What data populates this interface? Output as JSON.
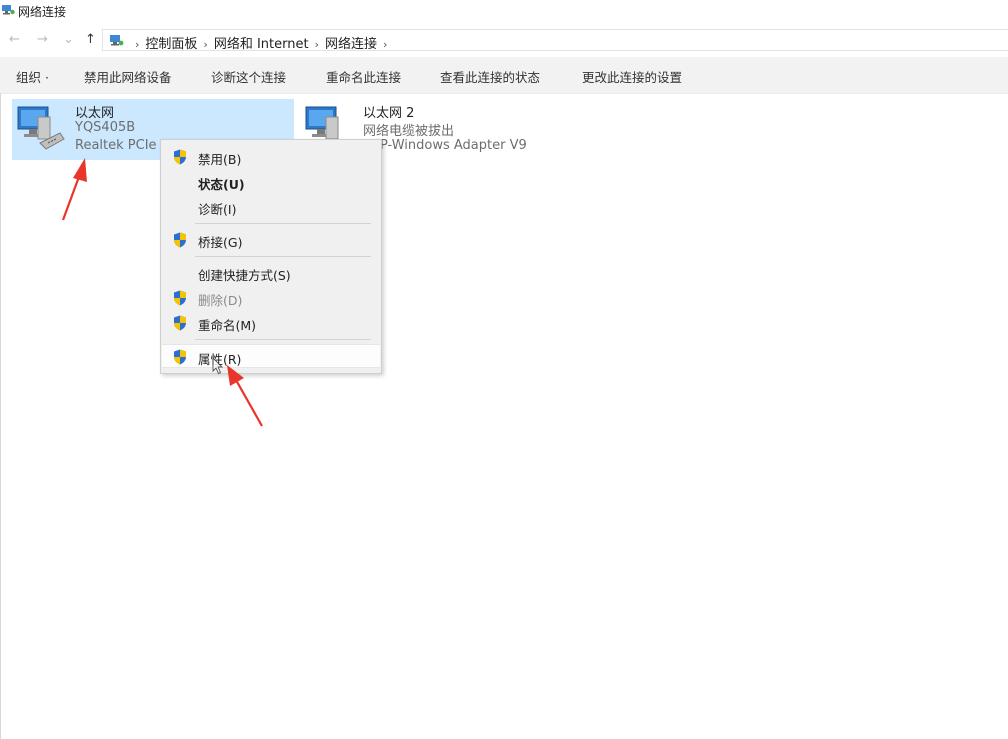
{
  "window": {
    "title": "网络连接"
  },
  "nav": {
    "back": "←",
    "forward": "→",
    "recent": "⌄",
    "up": "↑"
  },
  "breadcrumb": {
    "items": [
      "控制面板",
      "网络和 Internet",
      "网络连接"
    ],
    "separator": "›"
  },
  "toolbar": {
    "items": [
      "组织 ·",
      "禁用此网络设备",
      "诊断这个连接",
      "重命名此连接",
      "查看此连接的状态",
      "更改此连接的设置"
    ]
  },
  "adapters": [
    {
      "name": "以太网",
      "line2": "YQS405B",
      "line3": "Realtek PCIe",
      "selected": true
    },
    {
      "name": "以太网 2",
      "line2": "网络电缆被拔出",
      "line3": "P-Windows Adapter V9",
      "selected": false
    }
  ],
  "context_menu": {
    "items": [
      {
        "label": "禁用(B)",
        "shield": true,
        "bold": false,
        "disabled": false
      },
      {
        "label": "状态(U)",
        "shield": false,
        "bold": true,
        "disabled": false
      },
      {
        "label": "诊断(I)",
        "shield": false,
        "bold": false,
        "disabled": false
      },
      {
        "label": "桥接(G)",
        "shield": true,
        "bold": false,
        "disabled": false
      },
      {
        "label": "创建快捷方式(S)",
        "shield": false,
        "bold": false,
        "disabled": false
      },
      {
        "label": "删除(D)",
        "shield": true,
        "bold": false,
        "disabled": true
      },
      {
        "label": "重命名(M)",
        "shield": true,
        "bold": false,
        "disabled": false
      },
      {
        "label": "属性(R)",
        "shield": true,
        "bold": false,
        "disabled": false,
        "hovered": true
      }
    ]
  },
  "colors": {
    "selection": "#cce8ff",
    "annotation_arrow": "#e8362c",
    "toolbar_bg": "#f2f2f2"
  },
  "icons": {
    "shield": "uac-shield-icon",
    "adapter": "network-adapter-icon",
    "location": "network-folder-icon"
  }
}
